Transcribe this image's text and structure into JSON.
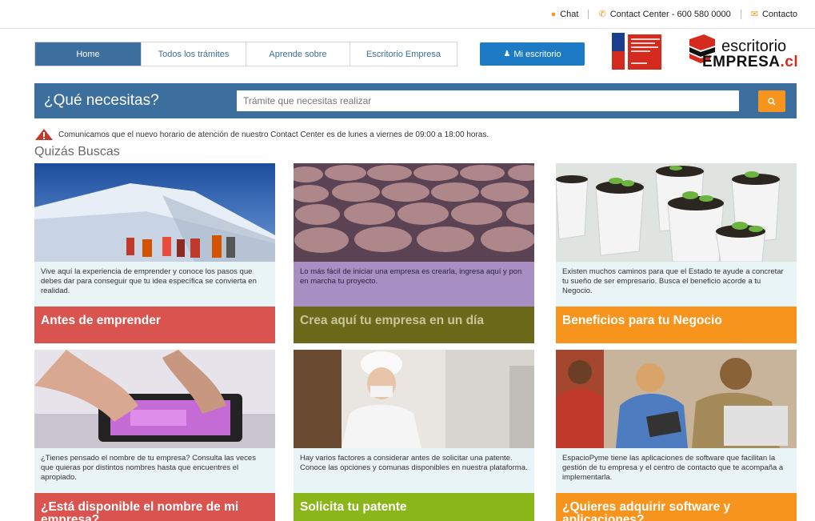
{
  "topbar": {
    "chat": "Chat",
    "contact_center": "Contact Center - 600 580 0000",
    "contacto": "Contacto"
  },
  "nav": {
    "items": [
      {
        "label": "Home",
        "active": true
      },
      {
        "label": "Todos los trámites",
        "active": false
      },
      {
        "label": "Aprende sobre",
        "active": false
      },
      {
        "label": "Escritorio Empresa",
        "active": false
      }
    ],
    "desk_button": "Mi escritorio"
  },
  "logo": {
    "line1": "escritorio",
    "line2": "EMPRESA",
    "suffix": ".cl"
  },
  "search": {
    "question": "¿Qué necesitas?",
    "placeholder": "Trámite que necesitas realizar"
  },
  "notice": "Comunicamos que el nuevo horario de atención de nuestro Contact Center es de lunes a viernes de 09:00 a 18:00 horas.",
  "section_title": "Quizás Buscas",
  "cards": [
    {
      "desc": "Vive aquí la experiencia de emprender y conoce los pasos que debes dar para conseguir que tu idea específica se convierta en realidad.",
      "title": "Antes de emprender",
      "color": "#d9534f"
    },
    {
      "desc": "Lo más fácil de iniciar una empresa es crearla, ingresa aquí y pon en marcha tu proyecto.",
      "title": "Crea aquí tu empresa en un día",
      "color": "#6b6a1b"
    },
    {
      "desc": "Existen muchos caminos para que el Estado te ayude a concretar tu sueño de ser empresario. Busca el beneficio acorde a tu Negocio.",
      "title": "Beneficios para tu Negocio",
      "color": "#f7941d"
    },
    {
      "desc": "¿Tienes pensado el nombre de tu empresa? Consulta las veces que quieras por distintos nombres hasta que encuentres el apropiado.",
      "title": "¿Está disponible el nombre de mi empresa?",
      "color": "#d9534f"
    },
    {
      "desc": "Hay varios factores a considerar antes de solicitar una patente. Conoce las opciones y comunas disponibles en nuestra plataforma.",
      "title": "Solicita tu patente",
      "color": "#8ab61a"
    },
    {
      "desc": "EspacioPyme tiene las aplicaciones de software que facilitan la gestión de tu empresa y el centro de contacto que te acompaña a implementarla.",
      "title": "¿Quieres adquirir software y aplicaciones?",
      "color": "#f7941d"
    }
  ]
}
